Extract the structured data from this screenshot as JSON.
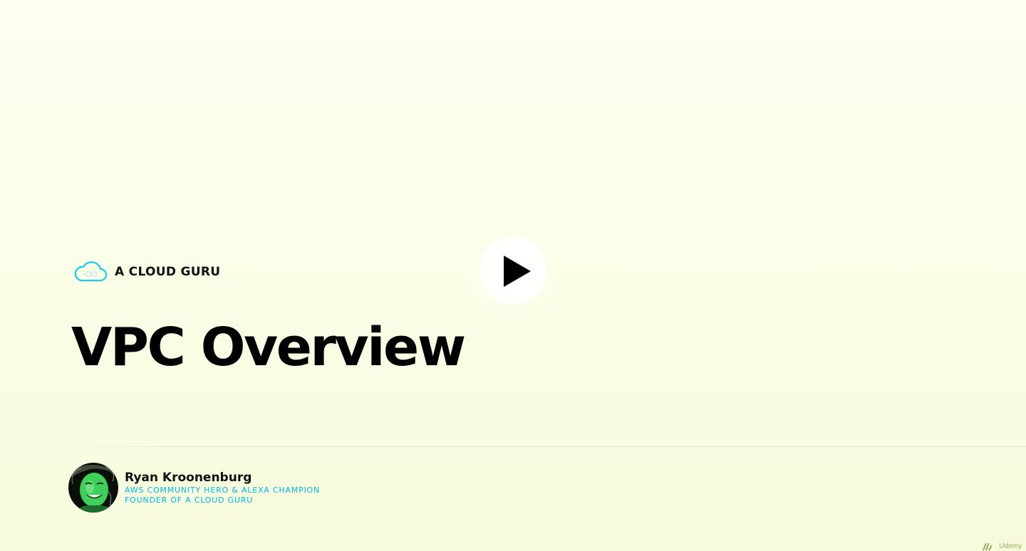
{
  "brand": {
    "name": "A CLOUD GURU",
    "logo_icon": "cloud-icon",
    "logo_color": "#1ac8f0"
  },
  "slide": {
    "title": "VPC Overview"
  },
  "presenter": {
    "name": "Ryan Kroonenburg",
    "role_line_1": "AWS COMMUNITY HERO & ALEXA CHAMPION",
    "role_line_2": "FOUNDER OF A CLOUD GURU",
    "role_color": "#00b8e0"
  },
  "player": {
    "play_icon": "play-icon"
  },
  "watermark": {
    "text": "Udemy",
    "icon": "udemy-logo-icon"
  },
  "colors": {
    "background": "#fbfee8",
    "text": "#000000",
    "accent": "#1ac8f0"
  }
}
